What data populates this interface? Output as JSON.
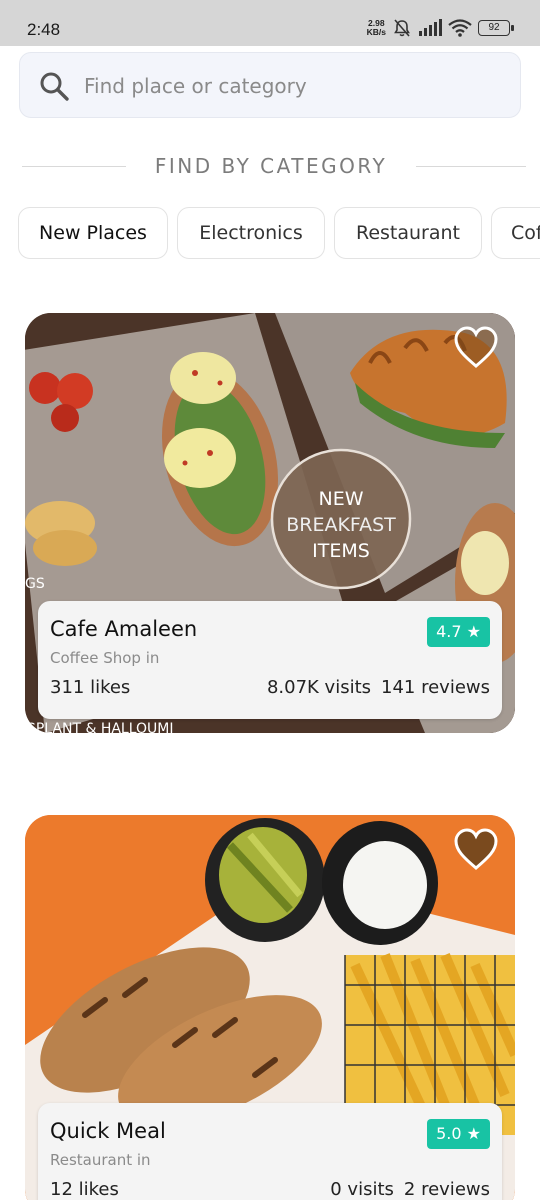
{
  "status_bar": {
    "time": "2:48",
    "net_speed_value": "2.98",
    "net_speed_unit": "KB/s",
    "battery": "92"
  },
  "search": {
    "placeholder": "Find place or category",
    "value": ""
  },
  "category_section": {
    "title": "FIND BY CATEGORY",
    "chips": [
      "New Places",
      "Electronics",
      "Restaurant",
      "Cof"
    ]
  },
  "places": [
    {
      "name": "Cafe Amaleen",
      "subtitle": "Coffee Shop in",
      "rating": "4.7 ★",
      "likes": "311 likes",
      "visits": "8.07K visits",
      "reviews": "141 reviews",
      "image_texts": [
        "NEW",
        "BREAKFAST",
        "ITEMS"
      ],
      "image_corner_text": "GPLANT & HALLOUMI",
      "image_side_text": "GS"
    },
    {
      "name": "Quick Meal",
      "subtitle": "Restaurant in",
      "rating": "5.0 ★",
      "likes": "12 likes",
      "visits": "0 visits",
      "reviews": "2 reviews"
    }
  ],
  "colors": {
    "rating_badge": "#18c3a4",
    "heart_fill": "#7a4a1e",
    "chip_border": "#e3e3e3"
  }
}
